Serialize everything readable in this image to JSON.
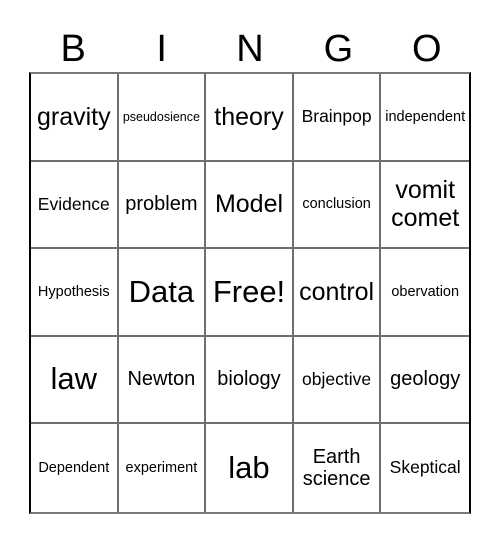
{
  "header": {
    "letters": [
      "B",
      "I",
      "N",
      "G",
      "O"
    ]
  },
  "grid": {
    "rows": [
      [
        "gravity",
        "pseudosience",
        "theory",
        "Brainpop",
        "independent"
      ],
      [
        "Evidence",
        "problem",
        "Model",
        "conclusion",
        "vomit comet"
      ],
      [
        "Hypothesis",
        "Data",
        "Free!",
        "control",
        "obervation"
      ],
      [
        "law",
        "Newton",
        "biology",
        "objective",
        "geology"
      ],
      [
        "Dependent",
        "experiment",
        "lab",
        "Earth science",
        "Skeptical"
      ]
    ]
  }
}
